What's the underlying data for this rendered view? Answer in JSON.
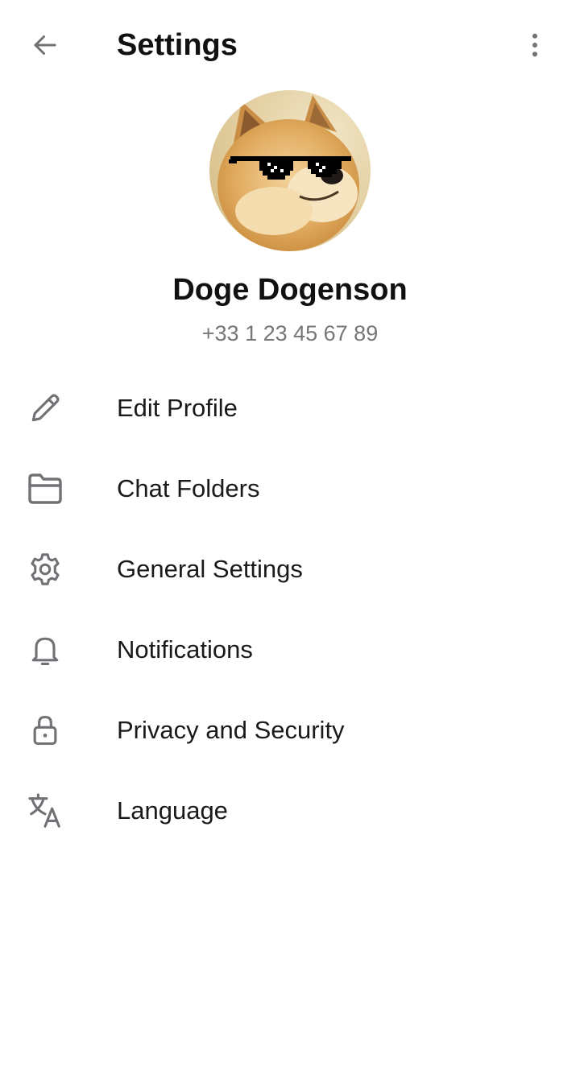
{
  "header": {
    "title": "Settings",
    "back_icon": "arrow-left-icon",
    "more_icon": "more-vertical-icon"
  },
  "profile": {
    "name": "Doge Dogenson",
    "phone": "+33 1 23 45 67 89",
    "avatar_icon": "doge-avatar"
  },
  "menu": {
    "items": [
      {
        "label": "Edit Profile",
        "icon": "pencil-icon"
      },
      {
        "label": "Chat Folders",
        "icon": "folder-icon"
      },
      {
        "label": "General Settings",
        "icon": "gear-icon"
      },
      {
        "label": "Notifications",
        "icon": "bell-icon"
      },
      {
        "label": "Privacy and Security",
        "icon": "lock-icon"
      },
      {
        "label": "Language",
        "icon": "translate-icon"
      }
    ]
  },
  "colors": {
    "icon": "#6f7175",
    "text": "#1a1a1a",
    "secondary_text": "#767676",
    "background": "#ffffff"
  }
}
